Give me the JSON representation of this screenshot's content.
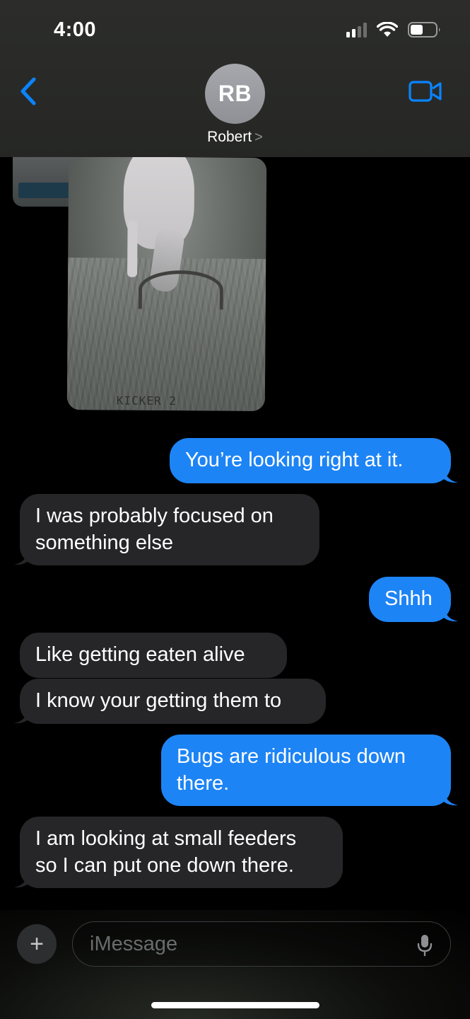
{
  "status_bar": {
    "time": "4:00",
    "icons": [
      "cellular-signal-icon",
      "wifi-icon",
      "battery-icon"
    ]
  },
  "header": {
    "avatar_initials": "RB",
    "contact_name": "Robert",
    "contact_chevron": ">",
    "back_icon": "chevron-left-icon",
    "video_icon": "video-camera-icon"
  },
  "attachment": {
    "photo_caption": "KICKER 2"
  },
  "messages": [
    {
      "direction": "sent",
      "text": "You’re looking right at it."
    },
    {
      "direction": "received",
      "lines": [
        "I was probably focused on",
        "something else"
      ]
    },
    {
      "direction": "sent",
      "text": "Shhh"
    },
    {
      "direction": "received",
      "text": "Like getting eaten alive"
    },
    {
      "direction": "received",
      "text": "I know your getting them to"
    },
    {
      "direction": "sent",
      "lines": [
        "Bugs are ridiculous down",
        "there."
      ]
    },
    {
      "direction": "received",
      "lines": [
        "I am looking at small feeders",
        "so I can put one down there."
      ]
    }
  ],
  "composer": {
    "placeholder": "iMessage",
    "plus_label": "+"
  },
  "colors": {
    "sent_bubble": "#1d84f5",
    "received_bubble": "#262628",
    "accent": "#0a84ff",
    "background": "#000000"
  }
}
